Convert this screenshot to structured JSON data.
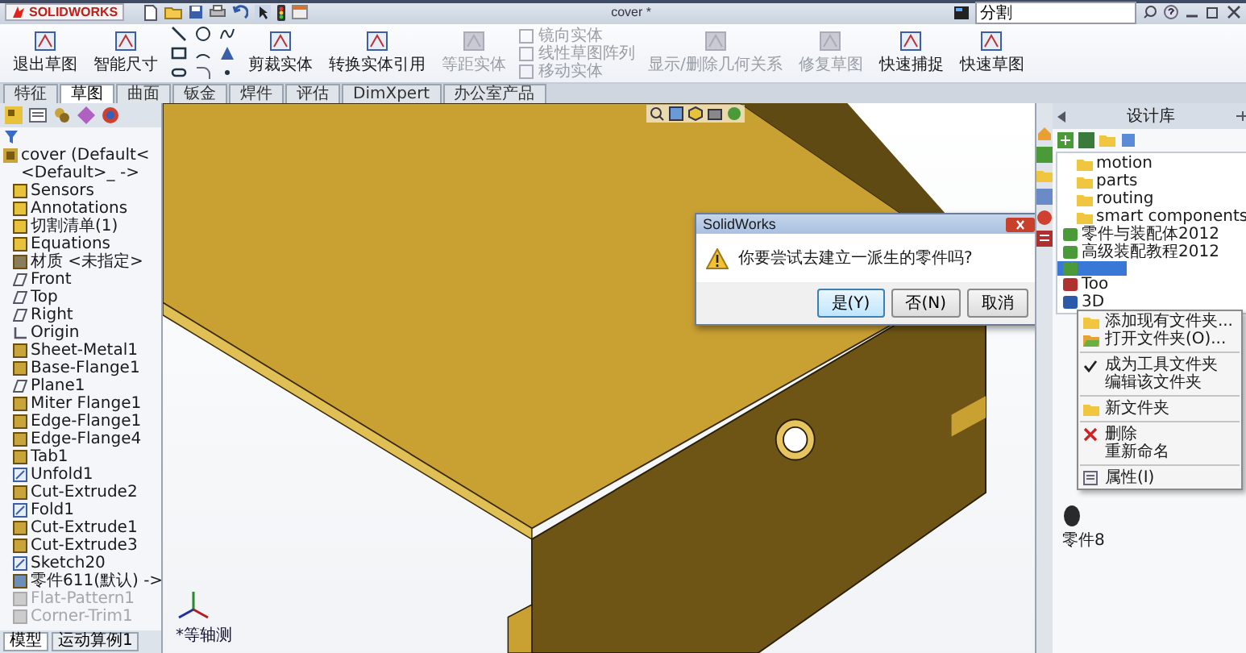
{
  "title_bar": {
    "logo": "SOLIDWORKS",
    "document_title": "cover *",
    "search": {
      "value": "分割"
    }
  },
  "ribbon": {
    "items": [
      {
        "kind": "button",
        "label": "退出草图",
        "disabled": false
      },
      {
        "kind": "button",
        "label": "智能尺寸",
        "disabled": false
      },
      {
        "kind": "tools"
      },
      {
        "kind": "button",
        "label": "剪裁实体",
        "disabled": false
      },
      {
        "kind": "button",
        "label": "转换实体引用",
        "disabled": false
      },
      {
        "kind": "button",
        "label": "等距实体",
        "disabled": true
      },
      {
        "kind": "list",
        "entries": [
          {
            "label": "镜向实体",
            "disabled": true
          },
          {
            "label": "线性草图阵列",
            "disabled": true
          },
          {
            "label": "移动实体",
            "disabled": true
          }
        ]
      },
      {
        "kind": "button",
        "label": "显示/删除几何关系",
        "disabled": true
      },
      {
        "kind": "button",
        "label": "修复草图",
        "disabled": true
      },
      {
        "kind": "button",
        "label": "快速捕捉",
        "disabled": false
      },
      {
        "kind": "button",
        "label": "快速草图",
        "disabled": false
      }
    ]
  },
  "ribbon_tabs": [
    {
      "label": "特征",
      "selected": false
    },
    {
      "label": "草图",
      "selected": true
    },
    {
      "label": "曲面",
      "selected": false
    },
    {
      "label": "钣金",
      "selected": false
    },
    {
      "label": "焊件",
      "selected": false
    },
    {
      "label": "评估",
      "selected": false
    },
    {
      "label": "DimXpert",
      "selected": false
    },
    {
      "label": "办公室产品",
      "selected": false
    }
  ],
  "feature_tree": {
    "root": "cover  (Default<<Default>_ ->",
    "items": [
      {
        "label": "Sensors",
        "kind": "folder",
        "disabled": false
      },
      {
        "label": "Annotations",
        "kind": "folder",
        "disabled": false
      },
      {
        "label": "切割清单(1)",
        "kind": "folder",
        "disabled": false
      },
      {
        "label": "Equations",
        "kind": "folder",
        "disabled": false
      },
      {
        "label": "材质 <未指定>",
        "kind": "material",
        "disabled": false
      },
      {
        "label": "Front",
        "kind": "plane",
        "disabled": false
      },
      {
        "label": "Top",
        "kind": "plane",
        "disabled": false
      },
      {
        "label": "Right",
        "kind": "plane",
        "disabled": false
      },
      {
        "label": "Origin",
        "kind": "origin",
        "disabled": false
      },
      {
        "label": "Sheet-Metal1",
        "kind": "feature",
        "disabled": false
      },
      {
        "label": "Base-Flange1",
        "kind": "feature",
        "disabled": false
      },
      {
        "label": "Plane1",
        "kind": "plane",
        "disabled": false
      },
      {
        "label": "Miter Flange1",
        "kind": "feature",
        "disabled": false
      },
      {
        "label": "Edge-Flange1",
        "kind": "feature",
        "disabled": false
      },
      {
        "label": "Edge-Flange4",
        "kind": "feature",
        "disabled": false
      },
      {
        "label": "Tab1",
        "kind": "feature",
        "disabled": false
      },
      {
        "label": "Unfold1",
        "kind": "sketch",
        "disabled": false
      },
      {
        "label": "Cut-Extrude2",
        "kind": "feature",
        "disabled": false
      },
      {
        "label": "Fold1",
        "kind": "sketch",
        "disabled": false
      },
      {
        "label": "Cut-Extrude1",
        "kind": "feature",
        "disabled": false
      },
      {
        "label": "Cut-Extrude3",
        "kind": "feature",
        "disabled": false
      },
      {
        "label": "Sketch20",
        "kind": "sketch",
        "disabled": false
      },
      {
        "label": "零件611(默认) ->",
        "kind": "part",
        "disabled": false
      },
      {
        "label": "Flat-Pattern1",
        "kind": "feature",
        "disabled": true
      },
      {
        "label": "Corner-Trim1",
        "kind": "feature",
        "disabled": true
      }
    ]
  },
  "bottom_tabs": [
    {
      "label": "模型",
      "selected": true
    },
    {
      "label": "运动算例1",
      "selected": false
    }
  ],
  "viewport": {
    "view_label": "*等轴测"
  },
  "dialog": {
    "title": "SolidWorks",
    "message": "你要尝试去建立一派生的零件吗?",
    "buttons": [
      {
        "label": "是(Y)",
        "focused": true
      },
      {
        "label": "否(N)",
        "focused": false
      },
      {
        "label": "取消",
        "focused": false
      }
    ]
  },
  "design_library": {
    "title": "设计库",
    "tree": [
      {
        "kind": "group",
        "children": [
          {
            "kind": "folder",
            "label": "motion",
            "selected": false
          },
          {
            "kind": "folder",
            "label": "parts",
            "selected": false
          },
          {
            "kind": "folder",
            "label": "routing",
            "selected": false
          },
          {
            "kind": "folder",
            "label": "smart components",
            "selected": false
          }
        ]
      },
      {
        "kind": "library",
        "label": "零件与装配体2012",
        "selected": false
      },
      {
        "kind": "library",
        "label": "高级装配教程2012",
        "selected": false
      },
      {
        "kind": "library",
        "selected": true
      },
      {
        "kind": "toolbox",
        "label": "Too",
        "selected": false
      },
      {
        "kind": "content",
        "label": "3D",
        "selected": false
      }
    ],
    "preview_item": "零件8"
  },
  "context_menu": {
    "items": [
      {
        "label": "添加现有文件夹...",
        "kind": "folder",
        "checked": false,
        "separator_before": false
      },
      {
        "label": "打开文件夹(O)...",
        "kind": "open",
        "checked": false,
        "separator_before": false
      },
      {
        "label": "成为工具文件夹",
        "kind": "plain",
        "checked": true,
        "separator_before": true
      },
      {
        "label": "编辑该文件夹",
        "kind": "plain",
        "checked": false,
        "separator_before": false
      },
      {
        "label": "新文件夹",
        "kind": "folder",
        "checked": false,
        "separator_before": true
      },
      {
        "label": "删除",
        "kind": "delete",
        "checked": false,
        "separator_before": true
      },
      {
        "label": "重新命名",
        "kind": "plain",
        "checked": false,
        "separator_before": false
      },
      {
        "label": "属性(I)",
        "kind": "properties",
        "checked": false,
        "separator_before": true
      }
    ]
  }
}
